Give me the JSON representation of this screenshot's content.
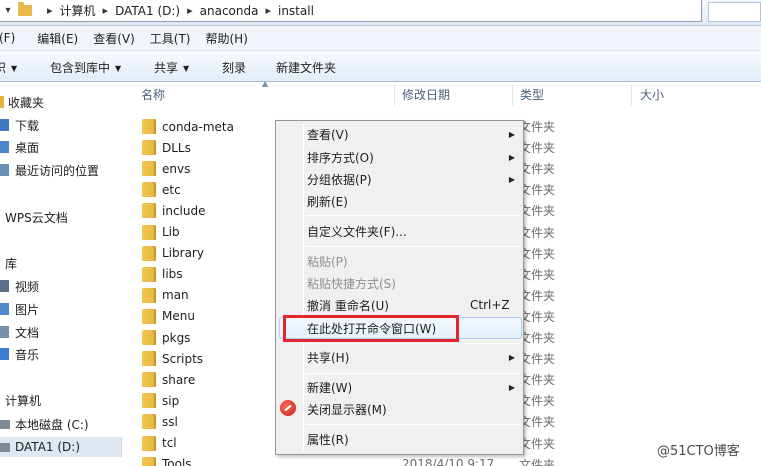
{
  "address_bar": {
    "crumbs": [
      "计算机",
      "DATA1 (D:)",
      "anaconda",
      "install"
    ]
  },
  "menu_bar": [
    "(F)",
    "编辑(E)",
    "查看(V)",
    "工具(T)",
    "帮助(H)"
  ],
  "command_bar": {
    "partial_left": "织",
    "include_library": "包含到库中",
    "share": "共享",
    "burn": "刻录",
    "new_folder": "新建文件夹"
  },
  "nav_pane": {
    "favorites": "收藏夹",
    "downloads": "下载",
    "desktop": "桌面",
    "recent": "最近访问的位置",
    "wps": "WPS云文档",
    "libraries": "库",
    "videos": "视频",
    "pictures": "图片",
    "documents": "文档",
    "music": "音乐",
    "computer": "计算机",
    "local_disk": "本地磁盘 (C:)",
    "data1": "DATA1 (D:)"
  },
  "columns": {
    "name": "名称",
    "date": "修改日期",
    "type": "类型",
    "size": "大小"
  },
  "files": [
    {
      "name": "conda-meta",
      "type": "文件夹",
      "date": ""
    },
    {
      "name": "DLLs",
      "type": "文件夹",
      "date": ""
    },
    {
      "name": "envs",
      "type": "文件夹",
      "date": ""
    },
    {
      "name": "etc",
      "type": "文件夹",
      "date": ""
    },
    {
      "name": "include",
      "type": "文件夹",
      "date": ""
    },
    {
      "name": "Lib",
      "type": "文件夹",
      "date": ""
    },
    {
      "name": "Library",
      "type": "文件夹",
      "date": ""
    },
    {
      "name": "libs",
      "type": "文件夹",
      "date": ""
    },
    {
      "name": "man",
      "type": "文件夹",
      "date": ""
    },
    {
      "name": "Menu",
      "type": "文件夹",
      "date": ""
    },
    {
      "name": "pkgs",
      "type": "文件夹",
      "date": ""
    },
    {
      "name": "Scripts",
      "type": "文件夹",
      "date": ""
    },
    {
      "name": "share",
      "type": "文件夹",
      "date": ""
    },
    {
      "name": "sip",
      "type": "文件夹",
      "date": ""
    },
    {
      "name": "ssl",
      "type": "文件夹",
      "date": ""
    },
    {
      "name": "tcl",
      "type": "文件夹",
      "date": ""
    },
    {
      "name": "Tools",
      "type": "文件夹",
      "date": "2018/4/10 9:17"
    }
  ],
  "context_menu": {
    "view": "查看(V)",
    "sort_by": "排序方式(O)",
    "group_by": "分组依据(P)",
    "refresh": "刷新(E)",
    "customize": "自定义文件夹(F)...",
    "paste": "粘贴(P)",
    "paste_shortcut": "粘贴快捷方式(S)",
    "undo_rename": "撤消 重命名(U)",
    "undo_shortcut": "Ctrl+Z",
    "open_cmd": "在此处打开命令窗口(W)",
    "share_with": "共享(H)",
    "new": "新建(W)",
    "close_display": "关闭显示器(M)",
    "properties": "属性(R)"
  },
  "watermark": "@51CTO博客",
  "colors": {
    "highlight_border": "#e3262b",
    "folder_yellow": "#e8b440"
  }
}
